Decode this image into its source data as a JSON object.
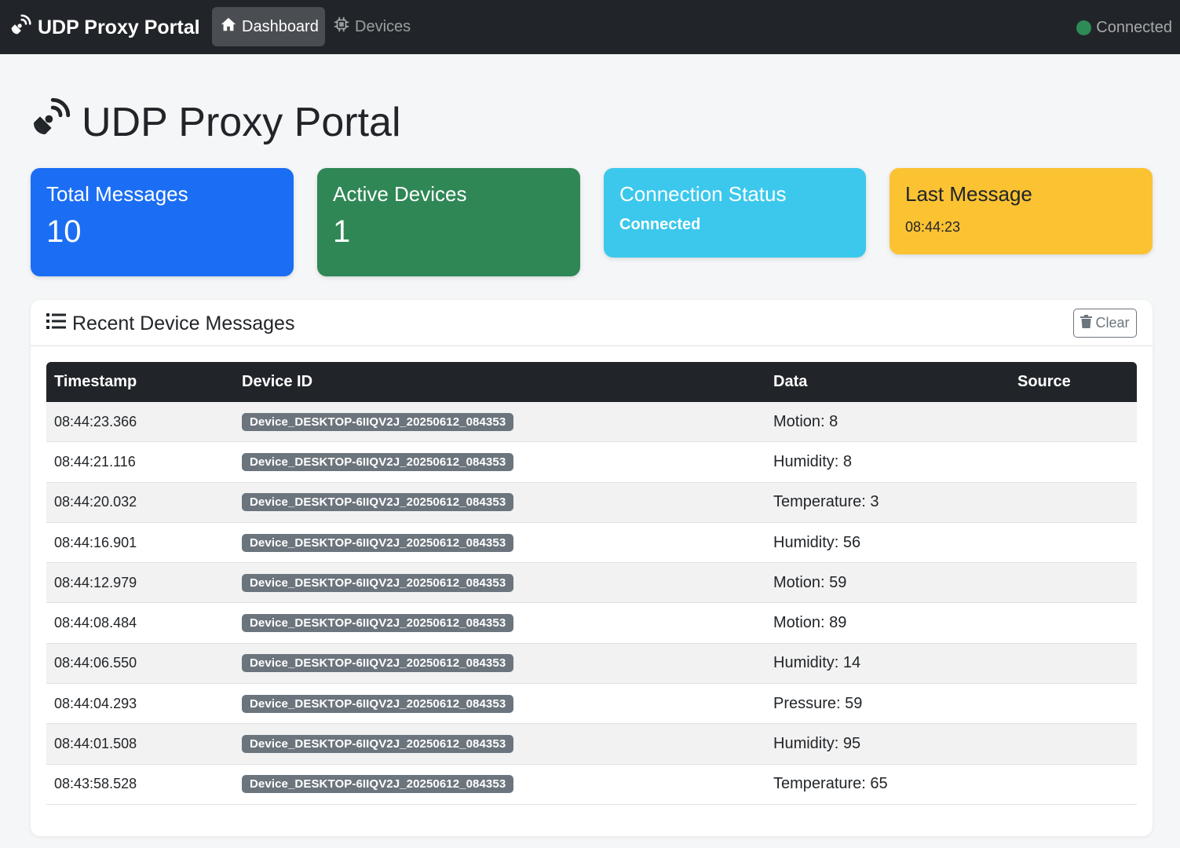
{
  "navbar": {
    "brand": "UDP Proxy Portal",
    "items": [
      {
        "label": "Dashboard",
        "icon": "home-icon",
        "active": true
      },
      {
        "label": "Devices",
        "icon": "chip-icon",
        "active": false
      }
    ],
    "connection_status": "Connected"
  },
  "page": {
    "title": "UDP Proxy Portal"
  },
  "stats": {
    "total_messages": {
      "title": "Total Messages",
      "value": "10"
    },
    "active_devices": {
      "title": "Active Devices",
      "value": "1"
    },
    "connection_status": {
      "title": "Connection Status",
      "value": "Connected"
    },
    "last_message": {
      "title": "Last Message",
      "value": "08:44:23"
    }
  },
  "messages_panel": {
    "title": "Recent Device Messages",
    "clear_label": "Clear",
    "columns": [
      "Timestamp",
      "Device ID",
      "Data",
      "Source"
    ],
    "rows": [
      {
        "timestamp": "08:44:23.366",
        "device_id": "Device_DESKTOP-6IIQV2J_20250612_084353",
        "data": "Motion: 8",
        "source": ""
      },
      {
        "timestamp": "08:44:21.116",
        "device_id": "Device_DESKTOP-6IIQV2J_20250612_084353",
        "data": "Humidity: 8",
        "source": ""
      },
      {
        "timestamp": "08:44:20.032",
        "device_id": "Device_DESKTOP-6IIQV2J_20250612_084353",
        "data": "Temperature: 3",
        "source": ""
      },
      {
        "timestamp": "08:44:16.901",
        "device_id": "Device_DESKTOP-6IIQV2J_20250612_084353",
        "data": "Humidity: 56",
        "source": ""
      },
      {
        "timestamp": "08:44:12.979",
        "device_id": "Device_DESKTOP-6IIQV2J_20250612_084353",
        "data": "Motion: 59",
        "source": ""
      },
      {
        "timestamp": "08:44:08.484",
        "device_id": "Device_DESKTOP-6IIQV2J_20250612_084353",
        "data": "Motion: 89",
        "source": ""
      },
      {
        "timestamp": "08:44:06.550",
        "device_id": "Device_DESKTOP-6IIQV2J_20250612_084353",
        "data": "Humidity: 14",
        "source": ""
      },
      {
        "timestamp": "08:44:04.293",
        "device_id": "Device_DESKTOP-6IIQV2J_20250612_084353",
        "data": "Pressure: 59",
        "source": ""
      },
      {
        "timestamp": "08:44:01.508",
        "device_id": "Device_DESKTOP-6IIQV2J_20250612_084353",
        "data": "Humidity: 95",
        "source": ""
      },
      {
        "timestamp": "08:43:58.528",
        "device_id": "Device_DESKTOP-6IIQV2J_20250612_084353",
        "data": "Temperature: 65",
        "source": ""
      }
    ]
  },
  "colors": {
    "navbar_bg": "#212529",
    "primary": "#1b6ef3",
    "success": "#2f8756",
    "info": "#3bc8ec",
    "warning": "#fbc232",
    "badge": "#6c757d",
    "status_dot": "#2e8b57"
  }
}
